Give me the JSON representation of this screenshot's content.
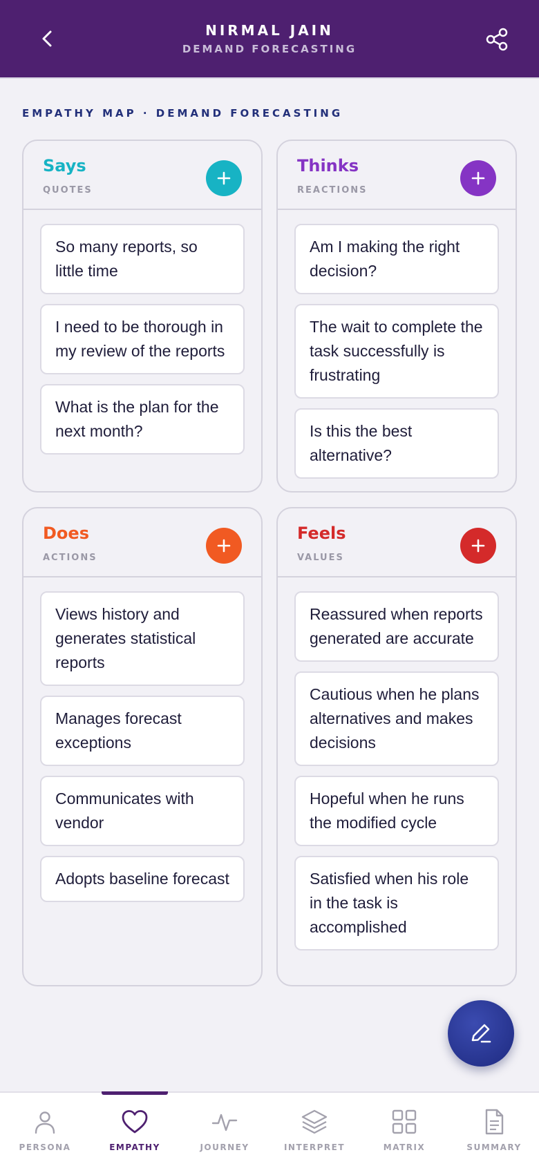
{
  "header": {
    "title": "NIRMAL JAIN",
    "subtitle": "DEMAND FORECASTING"
  },
  "section_label": "EMPATHY MAP · DEMAND FORECASTING",
  "quadrants": {
    "says": {
      "title": "Says",
      "subtitle": "QUOTES",
      "color": "#17b3c4",
      "items": [
        "So many reports, so little time",
        "I need to be thorough in my review of the reports",
        "What is the plan for the next month?"
      ]
    },
    "thinks": {
      "title": "Thinks",
      "subtitle": "REACTIONS",
      "color": "#8534c4",
      "items": [
        "Am I making the right decision?",
        "The wait to complete the task successfully is frustrating",
        "Is this the best alternative?"
      ]
    },
    "does": {
      "title": "Does",
      "subtitle": "ACTIONS",
      "color": "#f15a22",
      "items": [
        "Views history and generates statistical reports",
        "Manages forecast exceptions",
        "Communicates with vendor",
        "Adopts baseline forecast"
      ]
    },
    "feels": {
      "title": "Feels",
      "subtitle": "VALUES",
      "color": "#d42a2a",
      "items": [
        "Reassured when reports generated are accurate",
        "Cautious when he plans alternatives and makes decisions",
        "Hopeful when he runs the modified cycle",
        "Satisfied when his role in the task is accomplished"
      ]
    }
  },
  "bottom_nav": {
    "items": [
      {
        "label": "PERSONA",
        "icon": "person-icon"
      },
      {
        "label": "EMPATHY",
        "icon": "heart-icon",
        "active": true
      },
      {
        "label": "JOURNEY",
        "icon": "pulse-icon"
      },
      {
        "label": "INTERPRET",
        "icon": "layers-icon"
      },
      {
        "label": "MATRIX",
        "icon": "grid-icon"
      },
      {
        "label": "SUMMARY",
        "icon": "document-icon"
      }
    ]
  },
  "colors": {
    "header_bg": "#4e2070",
    "fab": "#2a379a",
    "section_label": "#23307a"
  }
}
